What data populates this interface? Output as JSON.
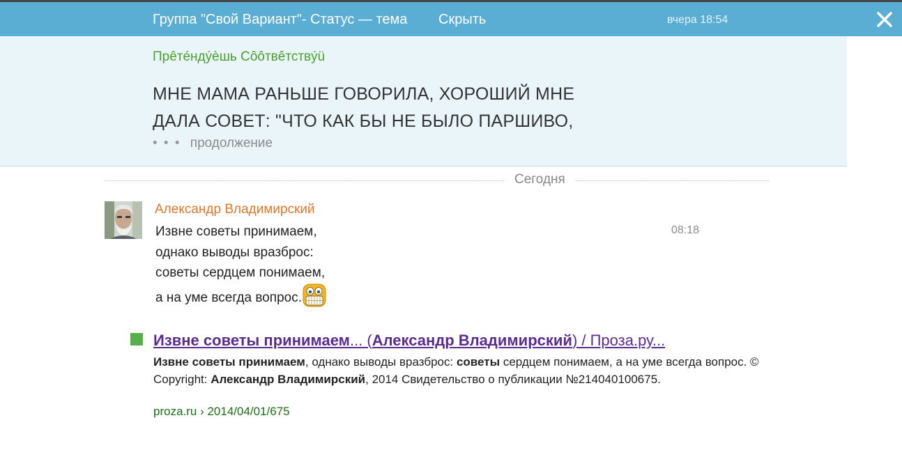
{
  "header": {
    "title": "Группа \"Свой Вариант\"- Статус — тема",
    "hide_label": "Скрыть",
    "time": "вчера 18:54"
  },
  "topic": {
    "author": "Прêтéндýèшь Сôôтвêтствýü",
    "text": "МНЕ МАМА РАНЬШЕ ГОВОРИЛА, ХОРОШИЙ МНЕ ДАЛА СОВЕТ: \"ЧТО КАК БЫ НЕ БЫЛО ПАРШИВО,",
    "more_dots": "• • •",
    "more_label": "продолжение"
  },
  "divider": {
    "label": "Сегодня"
  },
  "message": {
    "author": "Александр Владимирский",
    "time": "08:18",
    "lines": [
      "Извне советы принимаем,",
      "однако выводы вразброс:",
      "советы сердцем понимаем,",
      "а на уме всегда вопрос."
    ]
  },
  "result": {
    "title_a": "Извне советы принимаем",
    "title_b": "... (",
    "title_c": "Александр Владимирский",
    "title_d": ") / Проза.ру...",
    "snippet_1": "Извне советы принимаем",
    "snippet_2": ", однако выводы вразброс: ",
    "snippet_3": "советы",
    "snippet_4": " сердцем понимаем, а на уме всегда вопрос. © Copyright: ",
    "snippet_5": "Александр Владимирский",
    "snippet_6": ", 2014 Свидетельство о публикации №214040100675.",
    "url": "proza.ru › 2014/04/01/675"
  },
  "colors": {
    "header_bg": "#5aaed3",
    "topic_bg": "#eaf5fa",
    "topic_author": "#4aa02c",
    "message_author": "#e0772d",
    "result_link": "#5b2c8f",
    "result_url": "#1a6e15",
    "result_marker": "#58b04a"
  },
  "icons": [
    "close-icon",
    "avatar-photo",
    "grin-smiley-icon"
  ]
}
